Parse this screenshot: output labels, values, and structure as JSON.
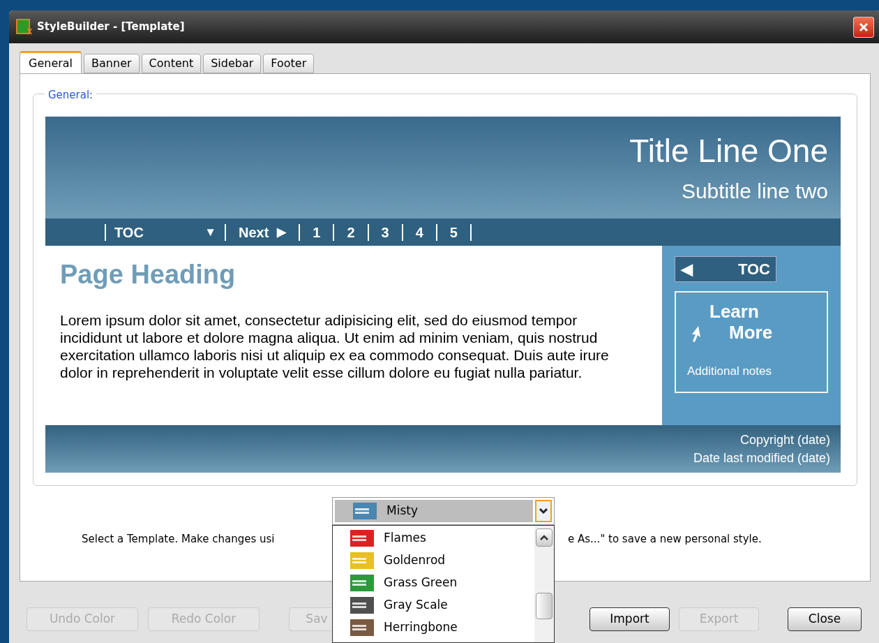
{
  "window": {
    "title": "StyleBuilder - [Template]"
  },
  "tabs": [
    {
      "label": "General",
      "selected": true
    },
    {
      "label": "Banner",
      "selected": false
    },
    {
      "label": "Content",
      "selected": false
    },
    {
      "label": "Sidebar",
      "selected": false
    },
    {
      "label": "Footer",
      "selected": false
    }
  ],
  "group_label": "General:",
  "preview": {
    "title": "Title Line One",
    "subtitle": "Subtitle line two",
    "nav": [
      {
        "label": "TOC",
        "glyph": "▼"
      },
      {
        "label": "Next",
        "glyph": "▶"
      },
      {
        "label": "1"
      },
      {
        "label": "2"
      },
      {
        "label": "3"
      },
      {
        "label": "4"
      },
      {
        "label": "5"
      }
    ],
    "heading": "Page Heading",
    "body": "Lorem ipsum dolor sit amet, consectetur adipisicing elit, sed do eiusmod tempor incididunt ut labore et dolore magna aliqua. Ut enim ad minim veniam, quis nostrud exercitation ullamco laboris nisi ut aliquip ex ea commodo consequat. Duis aute irure dolor in reprehenderit in voluptate velit esse cillum dolore eu fugiat nulla pariatur.",
    "sidebar_toc": {
      "glyph": "◀",
      "label": "TOC"
    },
    "learn_more": [
      "Learn",
      "More"
    ],
    "notes": "Additional notes",
    "footer": [
      "Copyright (date)",
      "Date last modified (date)"
    ]
  },
  "template_select": {
    "value": "Misty",
    "color": "#4a86b0",
    "options": [
      {
        "label": "Flames",
        "color": "#e02020"
      },
      {
        "label": "Goldenrod",
        "color": "#e8c020"
      },
      {
        "label": "Grass Green",
        "color": "#2a9a3a"
      },
      {
        "label": "Gray Scale",
        "color": "#505050"
      },
      {
        "label": "Herringbone",
        "color": "#7a5a40"
      }
    ]
  },
  "hint_left": "Select a Template. Make changes usi",
  "hint_right": "e As...\" to save a new personal style.",
  "buttons": [
    {
      "label": "Undo Color",
      "disabled": true
    },
    {
      "label": "Redo Color",
      "disabled": true
    },
    {
      "label": "Sav",
      "disabled": true
    },
    {
      "label": "Import",
      "disabled": false
    },
    {
      "label": "Export",
      "disabled": true
    },
    {
      "label": "Close",
      "disabled": false
    }
  ]
}
